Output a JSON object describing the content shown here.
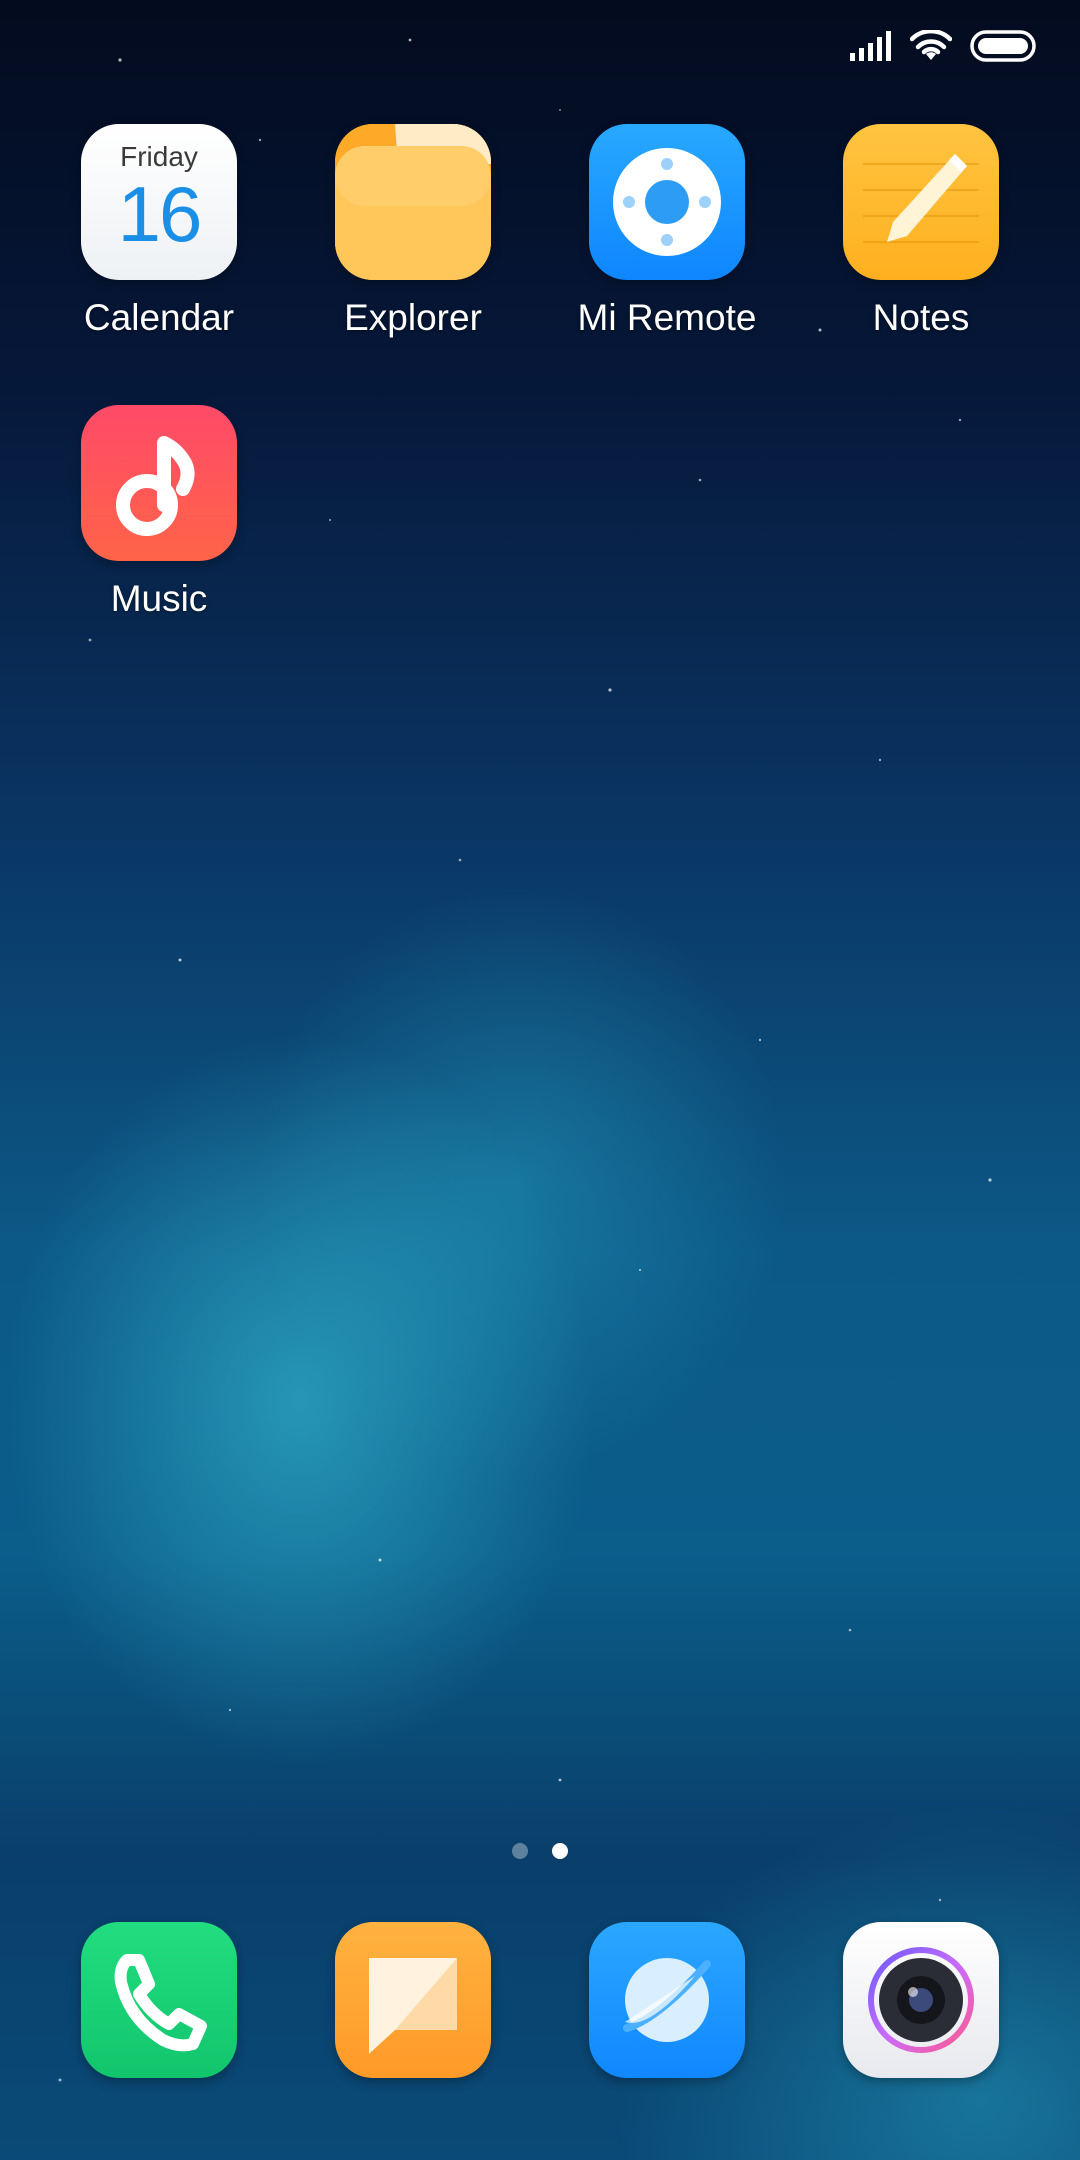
{
  "status_bar": {
    "icons": [
      "signal-icon",
      "wifi-icon",
      "battery-icon"
    ]
  },
  "apps": [
    {
      "label": "Calendar",
      "icon": "calendar-icon",
      "day": "Friday",
      "date": "16"
    },
    {
      "label": "Explorer",
      "icon": "folder-icon"
    },
    {
      "label": "Mi Remote",
      "icon": "remote-icon"
    },
    {
      "label": "Notes",
      "icon": "notes-icon"
    },
    {
      "label": "Music",
      "icon": "music-note-icon"
    }
  ],
  "pages": {
    "count": 2,
    "current": 2
  },
  "dock": [
    {
      "icon": "phone-icon",
      "color": "#1fd27a"
    },
    {
      "icon": "messages-icon",
      "color": "#ffa53a"
    },
    {
      "icon": "browser-icon",
      "color": "#1e9bff"
    },
    {
      "icon": "camera-icon",
      "color": "#f2f2f4"
    }
  ],
  "colors": {
    "calendar_accent": "#1b8fe6",
    "explorer": "#ffc24a",
    "mi_remote": "#1e9bff",
    "notes": "#ffbf2e",
    "music": "#ff4562"
  }
}
